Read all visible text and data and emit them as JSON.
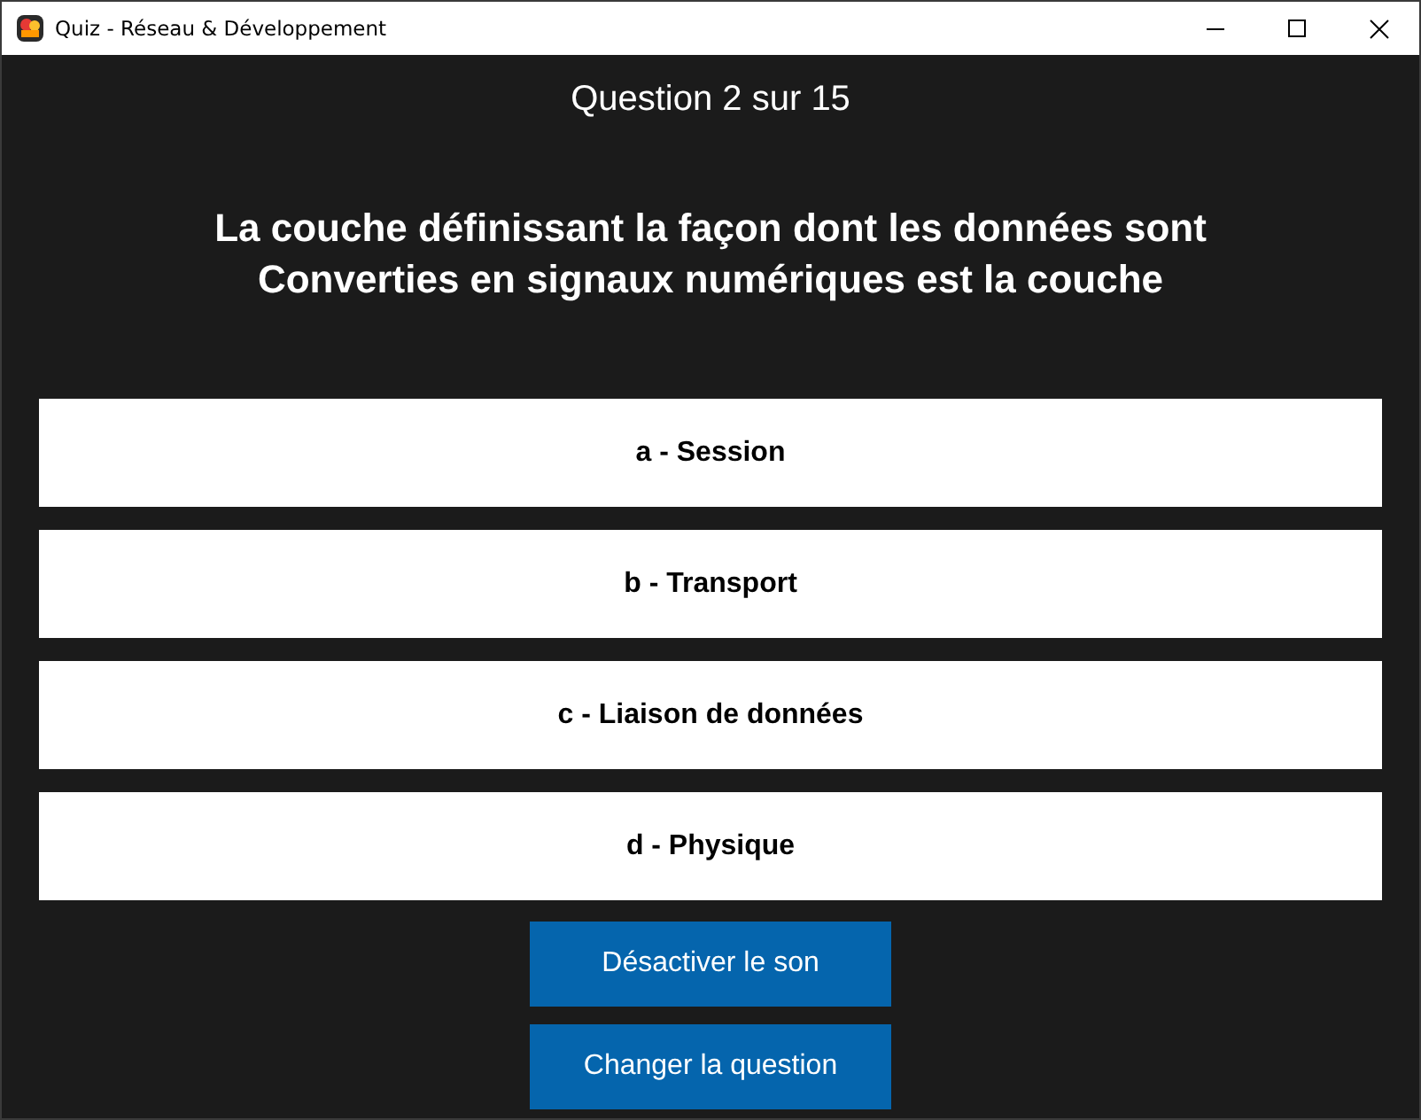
{
  "window": {
    "title": "Quiz - Réseau & Développement"
  },
  "counter": "Question 2 sur 15",
  "question": "La couche définissant la façon dont les données sont Converties en signaux numériques est la couche",
  "answers": [
    {
      "label": "a - Session"
    },
    {
      "label": "b - Transport"
    },
    {
      "label": "c - Liaison de données"
    },
    {
      "label": "d - Physique"
    }
  ],
  "buttons": [
    "Désactiver le son",
    "Changer la question"
  ]
}
